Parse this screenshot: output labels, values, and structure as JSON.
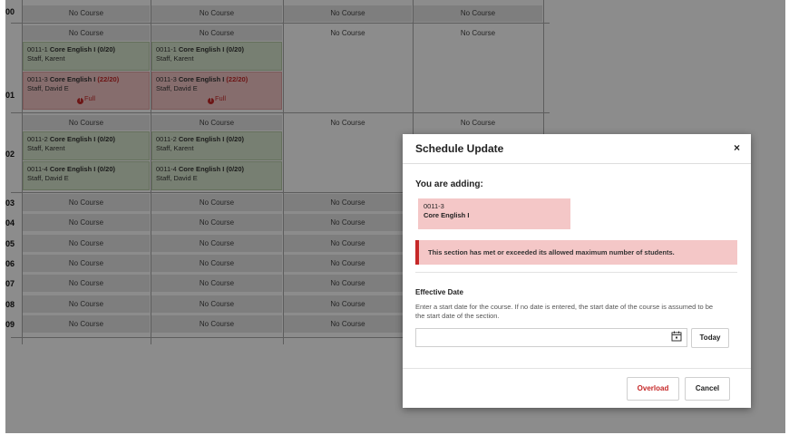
{
  "periods": [
    "00",
    "01",
    "02",
    "03",
    "04",
    "05",
    "06",
    "07",
    "08",
    "09"
  ],
  "no_course": "No Course",
  "courses": {
    "p01_a": {
      "code": "0011-1",
      "name": "Core English I",
      "ratio": "(0/20)",
      "teacher": "Staff, Karent"
    },
    "p01_b": {
      "code": "0011-3",
      "name": "Core English I",
      "ratio": "(22/20)",
      "teacher": "Staff, David E",
      "status": "Full"
    },
    "p02_a": {
      "code": "0011-2",
      "name": "Core English I",
      "ratio": "(0/20)",
      "teacher": "Staff, Karent"
    },
    "p02_b": {
      "code": "0011-4",
      "name": "Core English I",
      "ratio": "(0/20)",
      "teacher": "Staff, David E"
    }
  },
  "modal": {
    "title": "Schedule Update",
    "close": "×",
    "adding_label": "You are adding:",
    "section_code": "0011-3",
    "section_name": "Core English I",
    "alert": "This section has met or exceeded its allowed maximum number of students.",
    "effective_label": "Effective Date",
    "effective_help": "Enter a start date for the course. If no date is entered, the start date of the course is assumed to be the start date of the section.",
    "date_value": "",
    "today_button": "Today",
    "overload_button": "Overload",
    "cancel_button": "Cancel",
    "calendar_icon": "calendar-icon"
  },
  "colors": {
    "full_red": "#c62828",
    "green_cell": "#d9e8cf",
    "red_cell": "#f4c7c7"
  }
}
